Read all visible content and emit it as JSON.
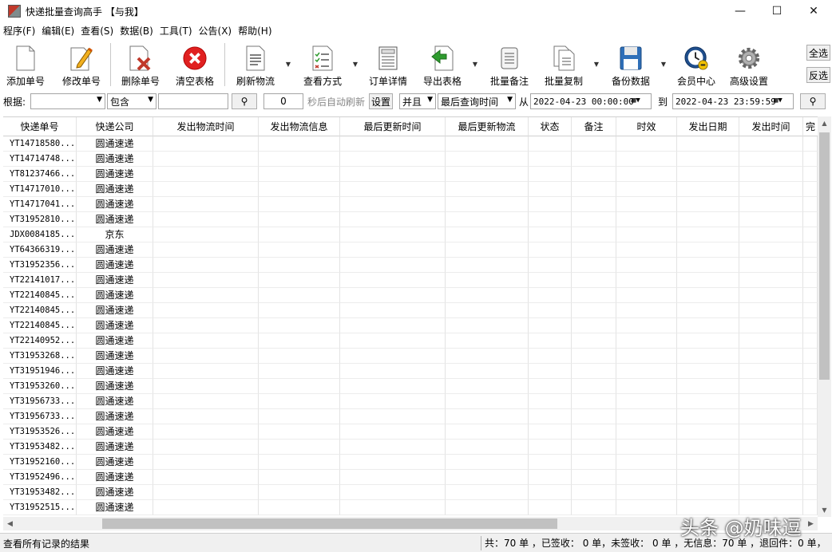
{
  "window": {
    "title": "快递批量查询高手 【与我】",
    "minimize": "—",
    "maximize": "☐",
    "close": "✕"
  },
  "menu": [
    "程序(F)",
    "编辑(E)",
    "查看(S)",
    "数据(B)",
    "工具(T)",
    "公告(X)",
    "帮助(H)"
  ],
  "toolbar": {
    "add": "添加单号",
    "edit": "修改单号",
    "delete": "删除单号",
    "clear": "清空表格",
    "refresh": "刷新物流",
    "view_mode": "查看方式",
    "order_detail": "订单详情",
    "export": "导出表格",
    "batch_note": "批量备注",
    "batch_copy": "批量复制",
    "backup": "备份数据",
    "member": "会员中心",
    "advanced": "高级设置",
    "select_all": "全选",
    "invert": "反选"
  },
  "filter": {
    "basis_label": "根据:",
    "basis_value": "",
    "match_value": "包含",
    "keyword_value": "",
    "refresh_seconds": "0",
    "refresh_label": "秒后自动刷新",
    "set_button": "设置",
    "logic_value": "并且",
    "time_field_value": "最后查询时间",
    "from_label": "从",
    "from_date": "2022-04-23 00:00:00",
    "to_label": "到",
    "to_date": "2022-04-23 23:59:59"
  },
  "columns": [
    "快递单号",
    "快递公司",
    "发出物流时间",
    "发出物流信息",
    "最后更新时间",
    "最后更新物流",
    "状态",
    "备注",
    "时效",
    "发出日期",
    "发出时间",
    "完"
  ],
  "rows": [
    {
      "no": "YT14718580...",
      "company": "圆通速递"
    },
    {
      "no": "YT14714748...",
      "company": "圆通速递"
    },
    {
      "no": "YT81237466...",
      "company": "圆通速递"
    },
    {
      "no": "YT14717010...",
      "company": "圆通速递"
    },
    {
      "no": "YT14717041...",
      "company": "圆通速递"
    },
    {
      "no": "YT31952810...",
      "company": "圆通速递"
    },
    {
      "no": "JDX0084185...",
      "company": "京东"
    },
    {
      "no": "YT64366319...",
      "company": "圆通速递"
    },
    {
      "no": "YT31952356...",
      "company": "圆通速递"
    },
    {
      "no": "YT22141017...",
      "company": "圆通速递"
    },
    {
      "no": "YT22140845...",
      "company": "圆通速递"
    },
    {
      "no": "YT22140845...",
      "company": "圆通速递"
    },
    {
      "no": "YT22140845...",
      "company": "圆通速递"
    },
    {
      "no": "YT22140952...",
      "company": "圆通速递"
    },
    {
      "no": "YT31953268...",
      "company": "圆通速递"
    },
    {
      "no": "YT31951946...",
      "company": "圆通速递"
    },
    {
      "no": "YT31953260...",
      "company": "圆通速递"
    },
    {
      "no": "YT31956733...",
      "company": "圆通速递"
    },
    {
      "no": "YT31956733...",
      "company": "圆通速递"
    },
    {
      "no": "YT31953526...",
      "company": "圆通速递"
    },
    {
      "no": "YT31953482...",
      "company": "圆通速递"
    },
    {
      "no": "YT31952160...",
      "company": "圆通速递"
    },
    {
      "no": "YT31952496...",
      "company": "圆通速递"
    },
    {
      "no": "YT31953482...",
      "company": "圆通速递"
    },
    {
      "no": "YT31952515...",
      "company": "圆通速递"
    }
  ],
  "status": {
    "left": "查看所有记录的结果",
    "right": "共：70 单 ，已签收： 0 单，未签收： 0 单 ，无信息：70 单 ，退回件：0 单，"
  },
  "watermark": "头条 @奶味逗",
  "colors": {
    "delete_icon": "#c0392b",
    "clear_icon": "#e02020",
    "export_icon": "#2e9b2e",
    "member_icon": "#1f4e8c"
  }
}
